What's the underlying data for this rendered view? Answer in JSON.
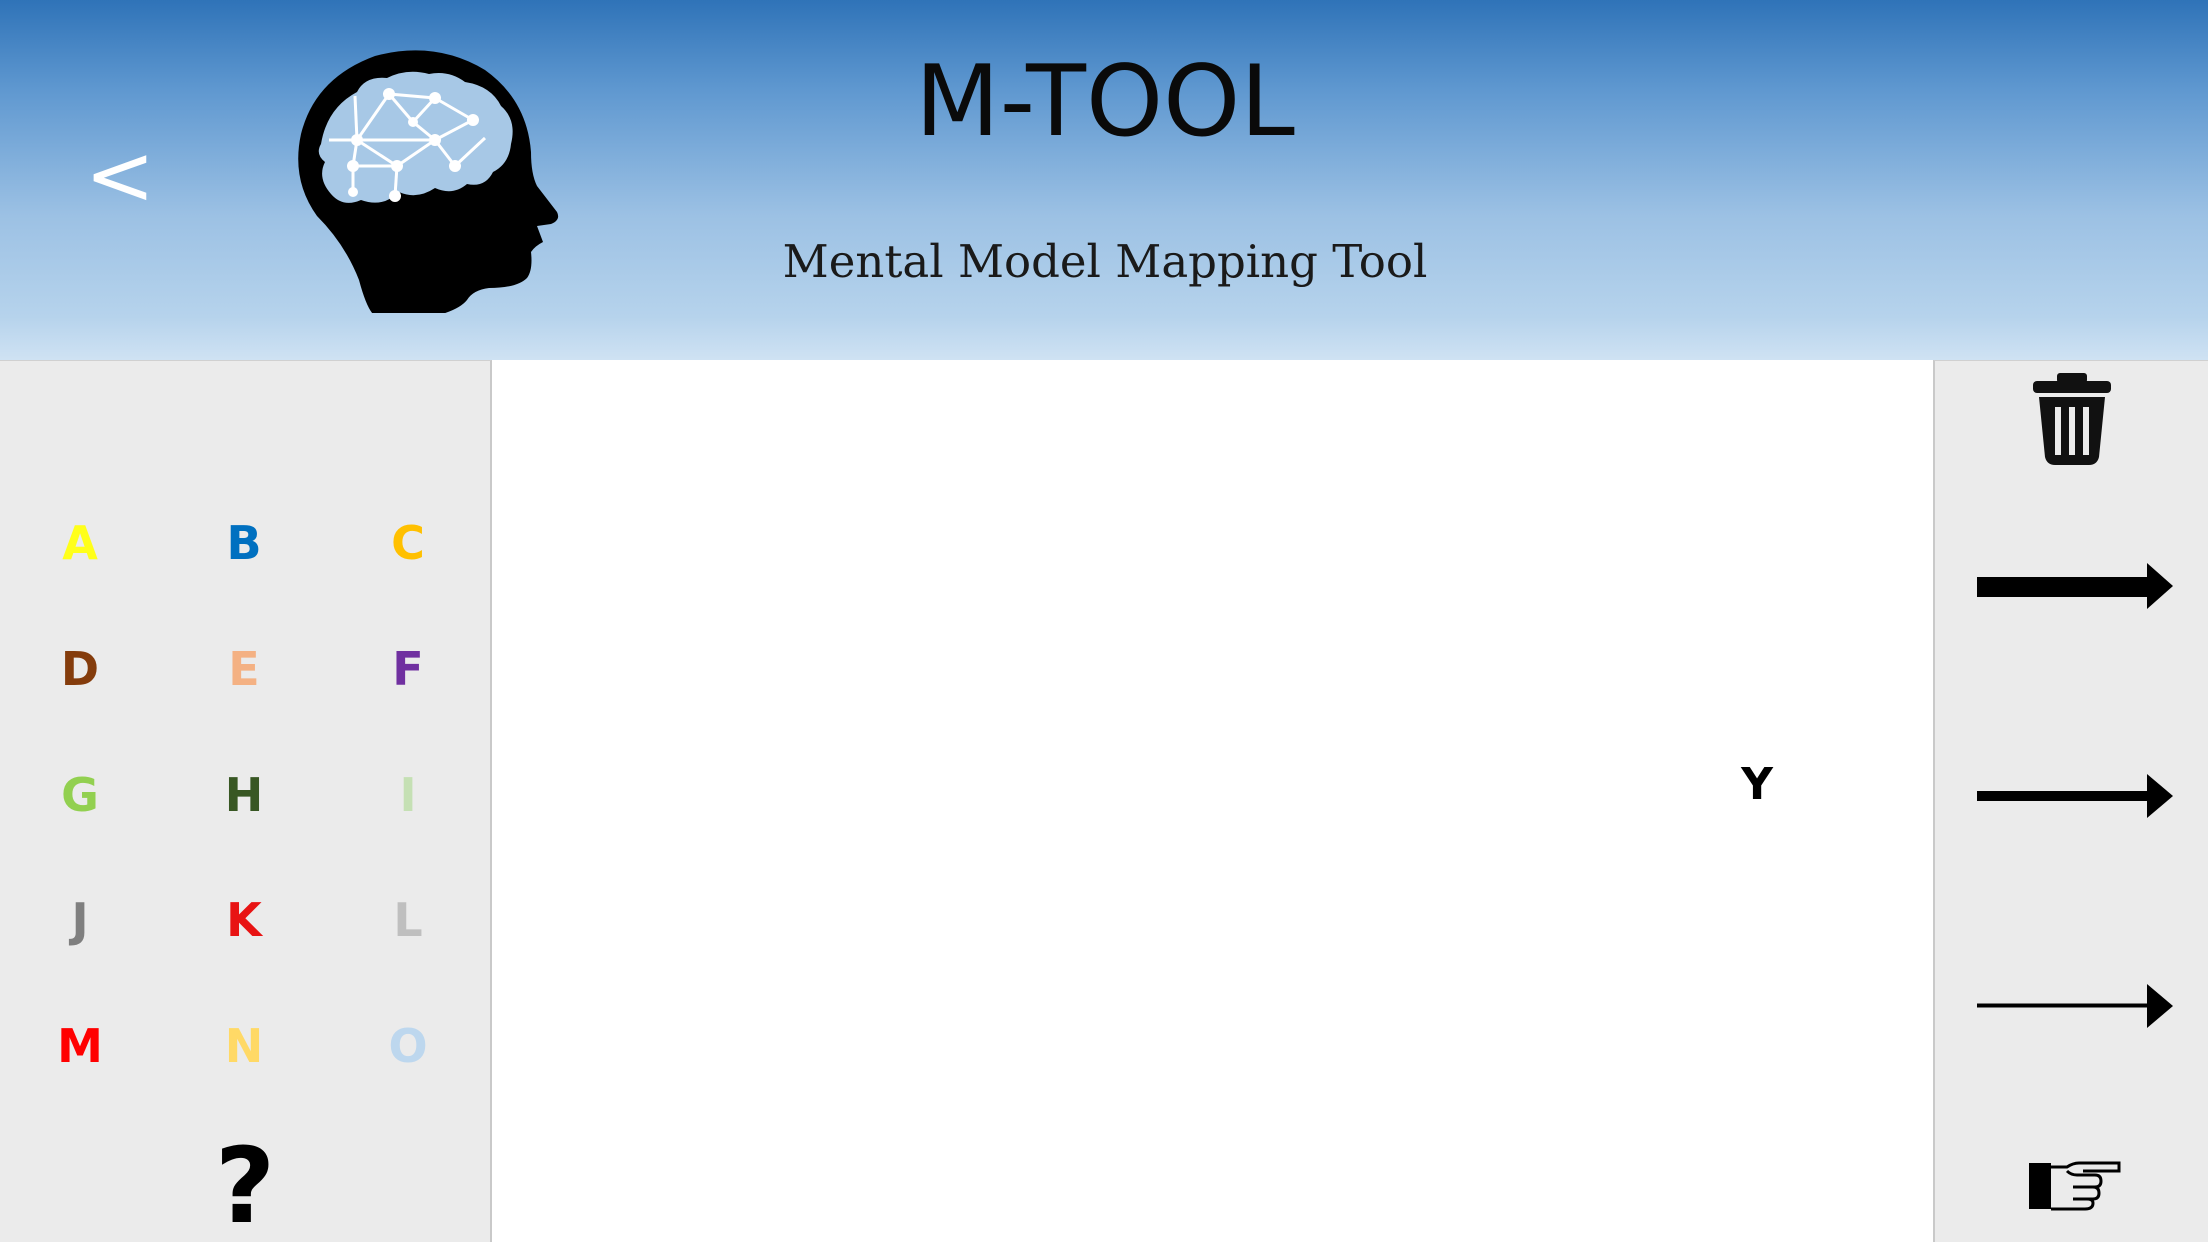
{
  "header": {
    "back_label": "<",
    "back_icon": "chevron-left-icon",
    "logo_icon": "brain-network-head-icon",
    "title": "M-TOOL",
    "subtitle": "Mental Model Mapping Tool"
  },
  "palette": {
    "letters": [
      {
        "label": "A",
        "color": "#ffff1a"
      },
      {
        "label": "B",
        "color": "#0070c0"
      },
      {
        "label": "C",
        "color": "#ffc000"
      },
      {
        "label": "D",
        "color": "#843c0c"
      },
      {
        "label": "E",
        "color": "#f4b183"
      },
      {
        "label": "F",
        "color": "#7030a0"
      },
      {
        "label": "G",
        "color": "#92d050"
      },
      {
        "label": "H",
        "color": "#385723"
      },
      {
        "label": "I",
        "color": "#c5e0b4"
      },
      {
        "label": "J",
        "color": "#7f7f7f"
      },
      {
        "label": "K",
        "color": "#e81313"
      },
      {
        "label": "L",
        "color": "#bfbfbf"
      },
      {
        "label": "M",
        "color": "#ff0000"
      },
      {
        "label": "N",
        "color": "#ffd966"
      },
      {
        "label": "O",
        "color": "#bdd7ee"
      }
    ],
    "help_label": "?"
  },
  "canvas": {
    "nodes": [
      {
        "label": "Y",
        "color": "#000000"
      }
    ]
  },
  "tools": {
    "delete_icon": "trash-icon",
    "arrows": [
      {
        "name": "arrow-thick-icon",
        "strength": "strong"
      },
      {
        "name": "arrow-medium-icon",
        "strength": "medium"
      },
      {
        "name": "arrow-thin-icon",
        "strength": "weak"
      }
    ],
    "pointer_icon": "pointing-hand-icon"
  },
  "colors": {
    "header_top": "#2f73b8",
    "header_bottom": "#cfe2f3",
    "panel_background": "#ebebeb",
    "canvas_background": "#ffffff"
  }
}
